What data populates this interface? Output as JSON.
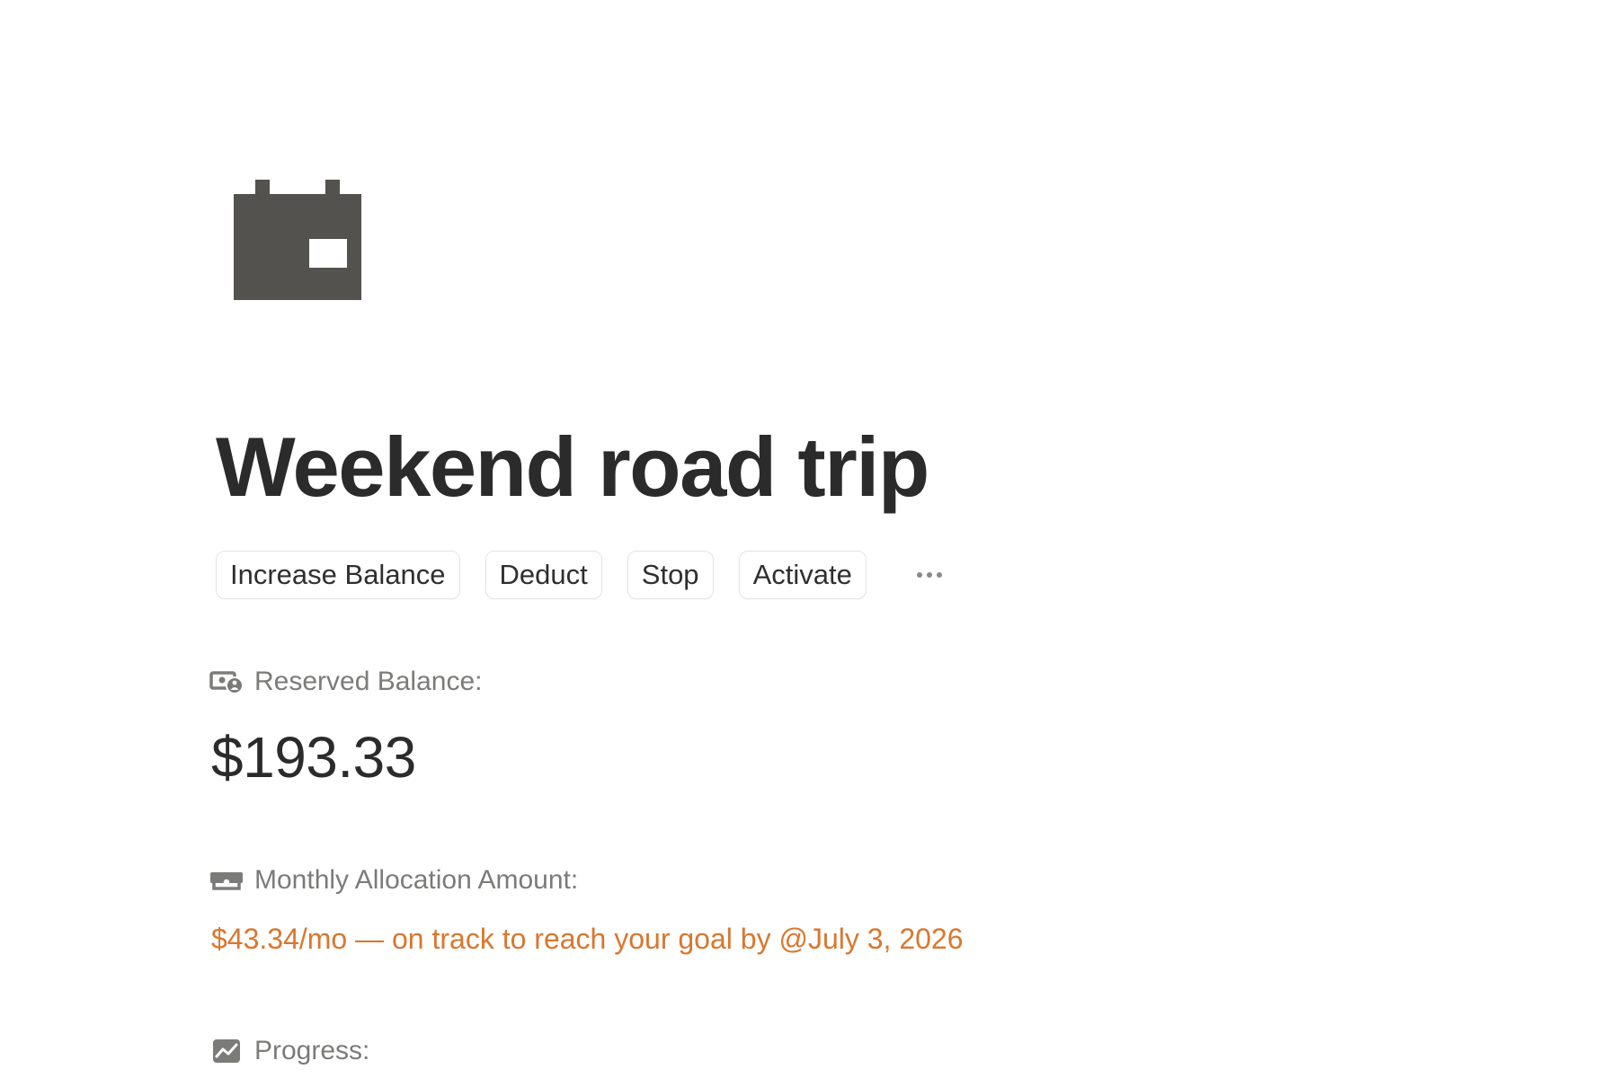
{
  "page": {
    "icon": "calendar-icon",
    "title": "Weekend road trip"
  },
  "actions": {
    "increase_balance": "Increase Balance",
    "deduct": "Deduct",
    "stop": "Stop",
    "activate": "Activate",
    "more_icon": "more-horizontal-icon"
  },
  "properties": {
    "reserved_balance": {
      "label": "Reserved Balance:",
      "icon": "money-lock-icon",
      "value": "$193.33"
    },
    "monthly_allocation": {
      "label": "Monthly Allocation Amount:",
      "icon": "cash-bill-icon",
      "value": "$43.34/mo — on track to reach your goal by @July 3, 2026"
    },
    "progress": {
      "label": "Progress:",
      "icon": "chart-trend-icon"
    }
  },
  "colors": {
    "icon_gray": "#54524e",
    "label_gray": "#7b7b79",
    "accent_orange": "#d9772f",
    "text_dark": "#2b2b2b"
  }
}
